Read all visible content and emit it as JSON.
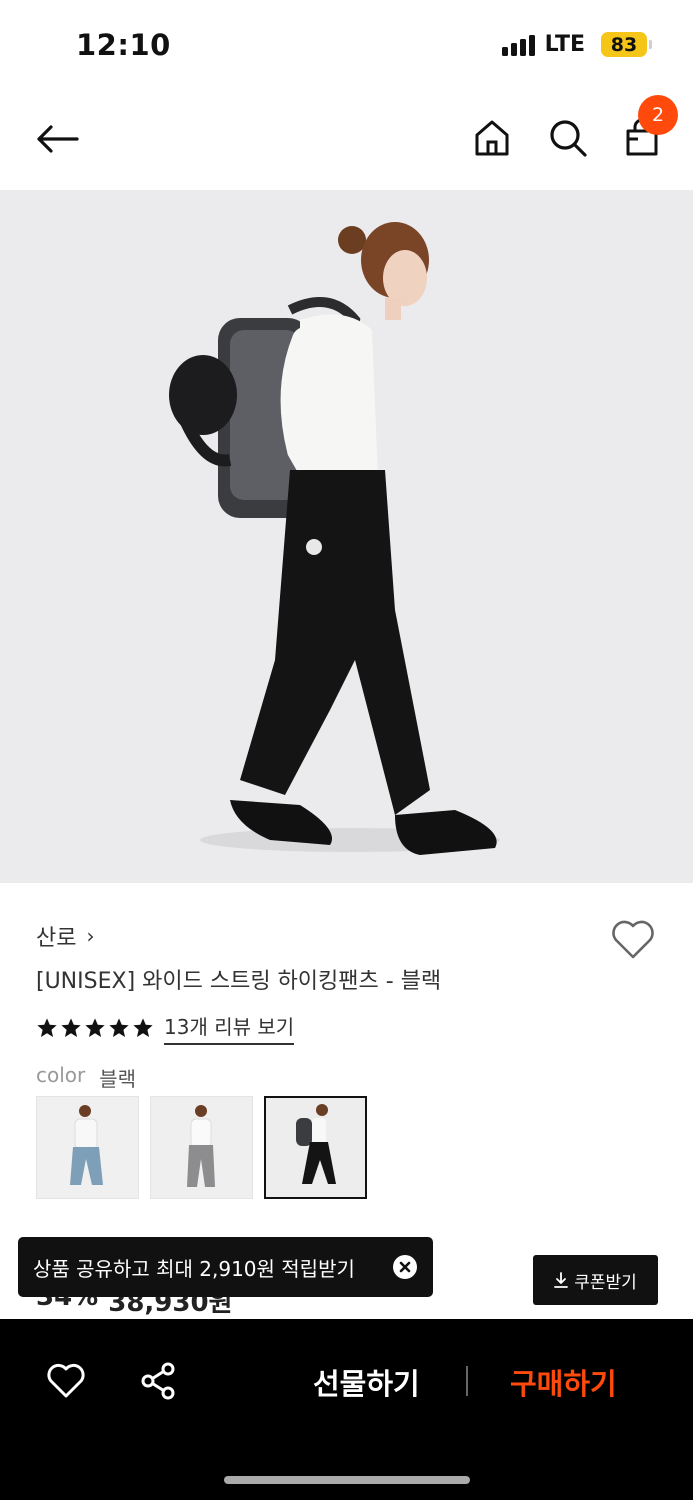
{
  "status": {
    "time": "12:10",
    "network": "LTE",
    "battery": "83"
  },
  "nav": {
    "cart_count": "2"
  },
  "icons": {
    "back": "arrow-left-icon",
    "home": "home-icon",
    "search": "search-icon",
    "cart": "shopping-bag-icon",
    "wish": "heart-icon",
    "share": "share-icon",
    "close": "close-icon",
    "download": "download-icon"
  },
  "product": {
    "brand": "산로",
    "brand_chevron": "›",
    "title": "[UNISEX] 와이드 스트링 하이킹팬츠 - 블랙",
    "rating_stars": 5,
    "review_link": "13개 리뷰 보기",
    "option_label": "color",
    "option_value": "블랙",
    "thumbnails": [
      "블루 데님 팬츠",
      "그레이 팬츠",
      "블랙 팬츠"
    ],
    "selected_thumbnail": 2,
    "discount": "34%",
    "price": "38,930원"
  },
  "toast": {
    "text": "상품 공유하고 최대 2,910원 적립받기"
  },
  "coupon": {
    "label": "쿠폰받기"
  },
  "bottom": {
    "gift_label": "선물하기",
    "buy_label": "구매하기"
  },
  "colors": {
    "accent": "#ff4a0b",
    "bar": "#000000",
    "battery": "#f5c518"
  }
}
